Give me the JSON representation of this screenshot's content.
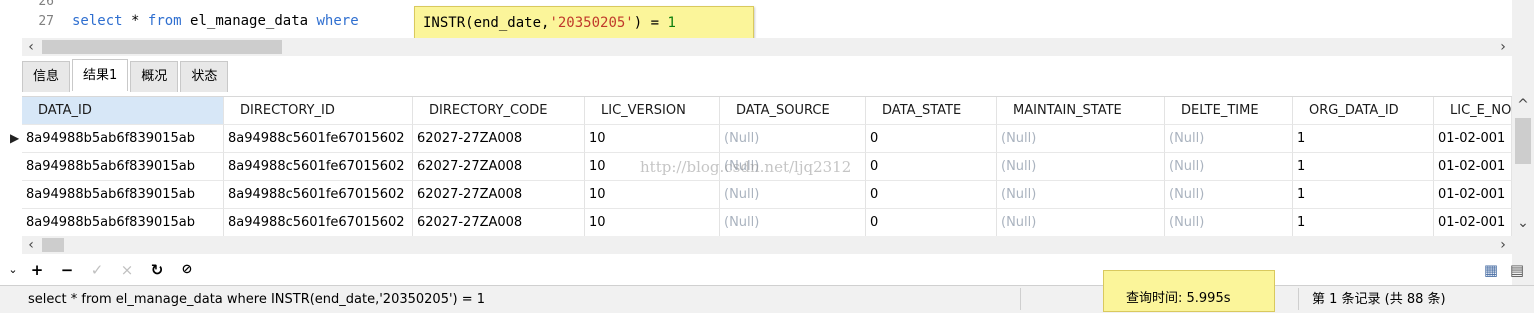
{
  "editor": {
    "line_numbers": [
      "26",
      "27"
    ],
    "sql_before": "select * from el_manage_data where ",
    "highlight": {
      "func": "INSTR(end_date,",
      "str": "'20350205'",
      "tail": ") = ",
      "num": "1"
    }
  },
  "tabs": [
    "信息",
    "结果1",
    "概况",
    "状态"
  ],
  "active_tab": 1,
  "grid": {
    "columns": [
      "DATA_ID",
      "DIRECTORY_ID",
      "DIRECTORY_CODE",
      "LIC_VERSION",
      "DATA_SOURCE",
      "DATA_STATE",
      "MAINTAIN_STATE",
      "DELTE_TIME",
      "ORG_DATA_ID",
      "LIC_E_NO"
    ],
    "rows": [
      [
        "8a94988b5ab6f839015ab",
        "8a94988c5601fe67015602",
        "62027-27ZA008",
        "10",
        "(Null)",
        "0",
        "(Null)",
        "(Null)",
        "1",
        "01-02-001"
      ],
      [
        "8a94988b5ab6f839015ab",
        "8a94988c5601fe67015602",
        "62027-27ZA008",
        "10",
        "(Null)",
        "0",
        "(Null)",
        "(Null)",
        "1",
        "01-02-001"
      ],
      [
        "8a94988b5ab6f839015ab",
        "8a94988c5601fe67015602",
        "62027-27ZA008",
        "10",
        "(Null)",
        "0",
        "(Null)",
        "(Null)",
        "1",
        "01-02-001"
      ],
      [
        "8a94988b5ab6f839015ab",
        "8a94988c5601fe67015602",
        "62027-27ZA008",
        "10",
        "(Null)",
        "0",
        "(Null)",
        "(Null)",
        "1",
        "01-02-001"
      ]
    ]
  },
  "watermark": "http://blog.csdn.net/ljq2312",
  "toolbar": {
    "icons": [
      "plus-icon",
      "minus-icon",
      "check-icon",
      "cancel-icon",
      "refresh-icon",
      "stop-icon"
    ]
  },
  "status": {
    "sql": "select * from el_manage_data where INSTR(end_date,'20350205') = 1",
    "query_time": "查询时间: 5.995s",
    "record": "第 1 条记录 (共 88 条)"
  },
  "colors": {
    "highlight": "#fbf59a",
    "keyword": "#2f6fd0",
    "string": "#c0392b",
    "null_text": "#aab3bf",
    "header_selected": "#d7e7f7"
  }
}
